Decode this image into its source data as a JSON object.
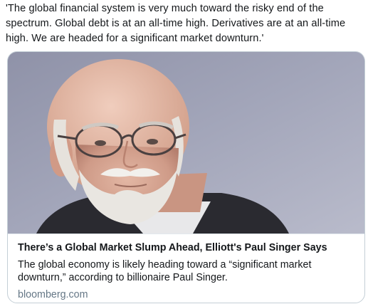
{
  "tweet": {
    "text": "'The global financial system is very much toward the risky end of the spectrum. Global debt is at an all-time high. Derivatives are at an all-time high. We are headed for a significant market downturn.'"
  },
  "card": {
    "image_description_icon": "portrait-photo",
    "title": "There’s a Global Market Slump Ahead, Elliott's Paul Singer Says",
    "description": "The global economy is likely heading toward a “significant market downturn,” according to billionaire Paul Singer.",
    "domain": "bloomberg.com"
  },
  "colors": {
    "text": "#14171a",
    "muted": "#657786",
    "border": "#c4cfd6",
    "image_background": "#9da0b4"
  }
}
